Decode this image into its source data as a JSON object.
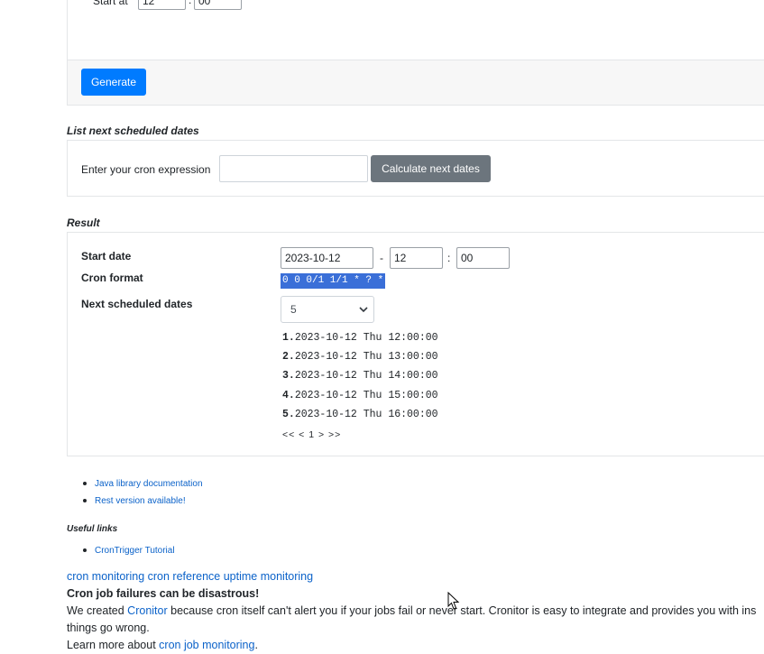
{
  "generator": {
    "start_at_label": "Start at",
    "hour_value": "12",
    "minute_value": "00",
    "generate_button": "Generate"
  },
  "list_next": {
    "title": "List next scheduled dates",
    "cron_label": "Enter your cron expression",
    "cron_input_value": "",
    "calculate_button": "Calculate next dates"
  },
  "result": {
    "title": "Result",
    "start_date_label": "Start date",
    "start_date_value": "2023-10-12",
    "dash": "-",
    "hour_value": "12",
    "colon": ":",
    "minute_value": "00",
    "cron_format_label": "Cron format",
    "cron_format_value": "0 0 0/1 1/1 * ? *",
    "next_dates_label": "Next scheduled dates",
    "count_selected": "5",
    "dates": [
      {
        "num": "1.",
        "text": "2023-10-12 Thu 12:00:00"
      },
      {
        "num": "2.",
        "text": "2023-10-12 Thu 13:00:00"
      },
      {
        "num": "3.",
        "text": "2023-10-12 Thu 14:00:00"
      },
      {
        "num": "4.",
        "text": "2023-10-12 Thu 15:00:00"
      },
      {
        "num": "5.",
        "text": "2023-10-12 Thu 16:00:00"
      }
    ],
    "pager": "<< < 1 > >>"
  },
  "doc_links": [
    "Java library documentation",
    "Rest version available!"
  ],
  "useful_links": {
    "title": "Useful links",
    "items": [
      "CronTrigger Tutorial"
    ]
  },
  "footer": {
    "nav_links": [
      "cron monitoring",
      "cron reference",
      "uptime monitoring"
    ],
    "headline": "Cron job failures can be disastrous!",
    "p1_pre": "We created ",
    "p1_link": "Cronitor",
    "p1_post": " because cron itself can't alert you if your jobs fail or never start. Cronitor is easy to integrate and provides you with ins",
    "p1_line2": "things go wrong.",
    "p2_pre": "Learn more about ",
    "p2_link": "cron job monitoring",
    "p2_post": "."
  },
  "colors": {
    "primary": "#007bff",
    "secondary": "#6c757d",
    "link": "#0b62c9",
    "selection": "#3a6fd8"
  }
}
